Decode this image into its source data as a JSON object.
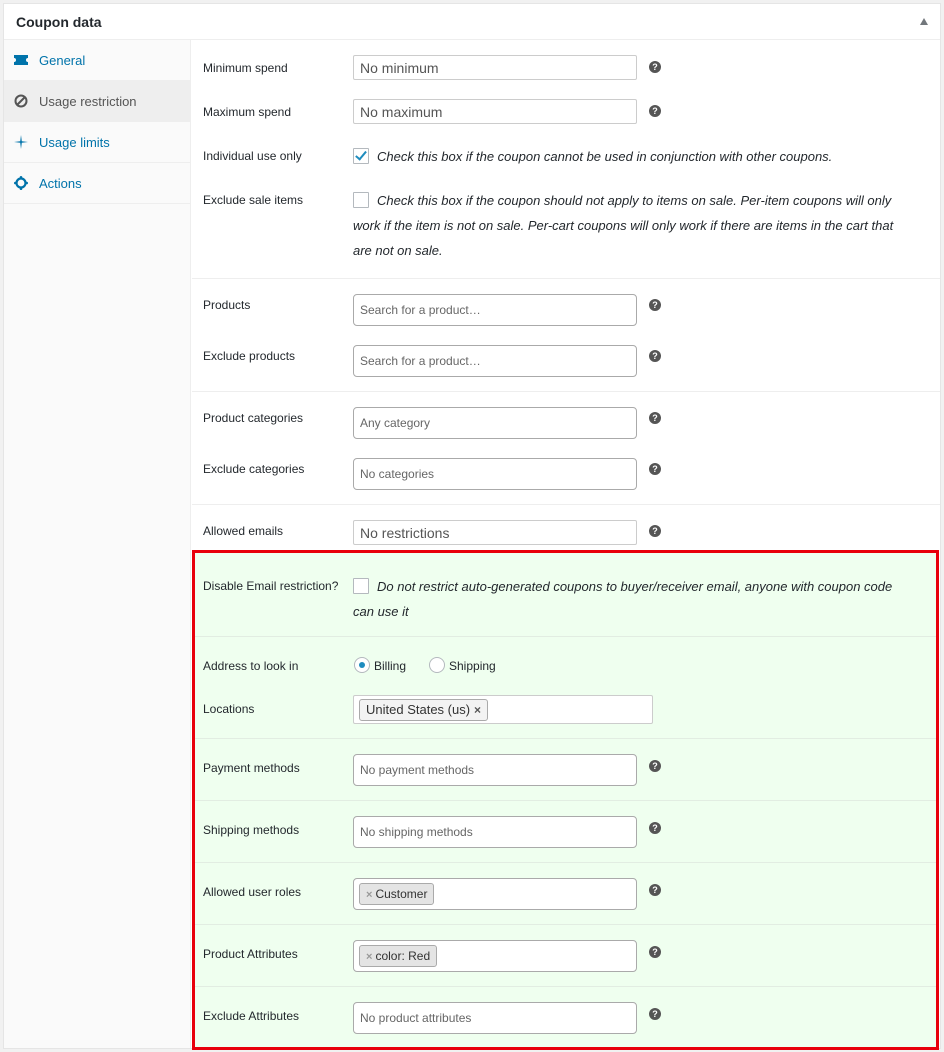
{
  "header": {
    "title": "Coupon data"
  },
  "tabs": [
    {
      "label": "General",
      "icon": "ticket-icon"
    },
    {
      "label": "Usage restriction",
      "icon": "block-icon"
    },
    {
      "label": "Usage limits",
      "icon": "sparkle-icon"
    },
    {
      "label": "Actions",
      "icon": "gear-icon"
    }
  ],
  "fields": {
    "min_spend": {
      "label": "Minimum spend",
      "placeholder": "No minimum"
    },
    "max_spend": {
      "label": "Maximum spend",
      "placeholder": "No maximum"
    },
    "individual_use": {
      "label": "Individual use only",
      "desc": "Check this box if the coupon cannot be used in conjunction with other coupons.",
      "checked": true
    },
    "exclude_sale": {
      "label": "Exclude sale items",
      "desc": "Check this box if the coupon should not apply to items on sale. Per-item coupons will only work if the item is not on sale. Per-cart coupons will only work if there are items in the cart that are not on sale.",
      "checked": false
    },
    "products": {
      "label": "Products",
      "placeholder": "Search for a product…"
    },
    "exclude_products": {
      "label": "Exclude products",
      "placeholder": "Search for a product…"
    },
    "product_categories": {
      "label": "Product categories",
      "placeholder": "Any category"
    },
    "exclude_categories": {
      "label": "Exclude categories",
      "placeholder": "No categories"
    },
    "allowed_emails": {
      "label": "Allowed emails",
      "placeholder": "No restrictions"
    }
  },
  "highlighted": {
    "disable_email": {
      "label": "Disable Email restriction?",
      "desc": "Do not restrict auto-generated coupons to buyer/receiver email, anyone with coupon code can use it",
      "checked": false
    },
    "address": {
      "label": "Address to look in",
      "options": [
        "Billing",
        "Shipping"
      ],
      "selected": "Billing"
    },
    "locations": {
      "label": "Locations",
      "chip": "United States (us)",
      "chip_remove": "×"
    },
    "payment_methods": {
      "label": "Payment methods",
      "placeholder": "No payment methods"
    },
    "shipping_methods": {
      "label": "Shipping methods",
      "placeholder": "No shipping methods"
    },
    "user_roles": {
      "label": "Allowed user roles",
      "chip": "Customer",
      "chip_remove": "×"
    },
    "product_attributes": {
      "label": "Product Attributes",
      "chip": "color: Red",
      "chip_remove": "×"
    },
    "exclude_attributes": {
      "label": "Exclude Attributes",
      "placeholder": "No product attributes"
    }
  },
  "help_glyph": "?",
  "colors": {
    "accent": "#0073aa",
    "highlight_border": "#e8000b",
    "highlight_bg": "#efffef"
  }
}
